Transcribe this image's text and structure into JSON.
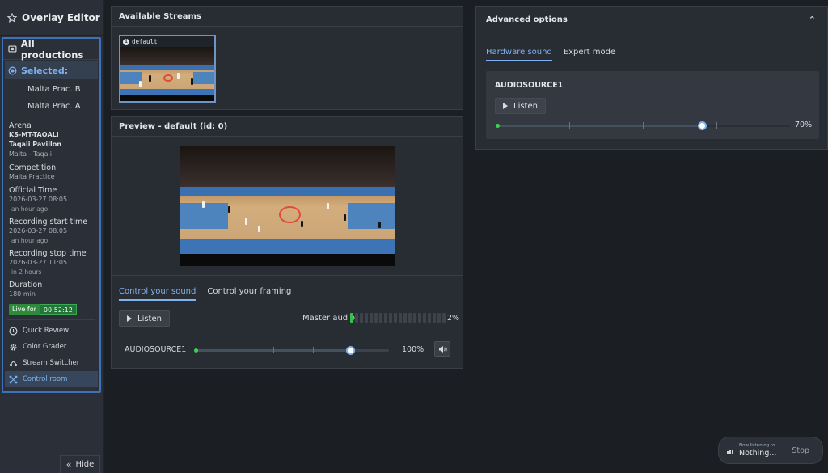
{
  "sidebar": {
    "title": "Overlay Editor",
    "all_productions": "All productions",
    "selected": "Selected:",
    "productions": [
      "Malta Prac. B",
      "Malta Prac. A"
    ],
    "info": {
      "arena_label": "Arena",
      "arena_code": "KS-MT-TAQALI",
      "arena_name": "Taqali Pavillon",
      "arena_location": "Malta - Taqali",
      "competition_label": "Competition",
      "competition_value": "Malta Practice",
      "official_time_label": "Official Time",
      "official_time_value": "2026-03-27 08:05",
      "official_time_rel": "an hour ago",
      "rec_start_label": "Recording start time",
      "rec_start_value": "2026-03-27 08:05",
      "rec_start_rel": "an hour ago",
      "rec_stop_label": "Recording stop time",
      "rec_stop_value": "2026-03-27 11:05",
      "rec_stop_rel": "in 2 hours",
      "duration_label": "Duration",
      "duration_value": "180 min",
      "live_label": "Live for",
      "live_value": "00:52:12"
    },
    "nav": [
      {
        "label": "Quick Review",
        "icon": "clock-icon"
      },
      {
        "label": "Color Grader",
        "icon": "gear-icon"
      },
      {
        "label": "Stream Switcher",
        "icon": "switch-icon"
      },
      {
        "label": "Control room",
        "icon": "control-room-icon"
      }
    ],
    "hide_label": "Hide"
  },
  "streams": {
    "title": "Available Streams",
    "items": [
      {
        "label": "default"
      }
    ]
  },
  "preview": {
    "title": "Preview - default (id: 0)",
    "tabs": [
      "Control your sound",
      "Control your framing"
    ],
    "listen_label": "Listen",
    "master_label": "Master audio",
    "master_level": 2,
    "master_value": "2%",
    "source_label": "AUDIOSOURCE1",
    "source_level": 100,
    "source_value": "100%"
  },
  "advanced": {
    "title": "Advanced options",
    "tabs": [
      "Hardware sound",
      "Expert mode"
    ],
    "source_label": "AUDIOSOURCE1",
    "listen_label": "Listen",
    "level": 70,
    "value": "70%"
  },
  "now_listening": {
    "small": "Now listening to...",
    "big": "Nothing...",
    "stop_label": "Stop"
  },
  "colors": {
    "accent": "#7fb2ee",
    "live": "#2e8b3c",
    "meter_on": "#35c24a"
  }
}
